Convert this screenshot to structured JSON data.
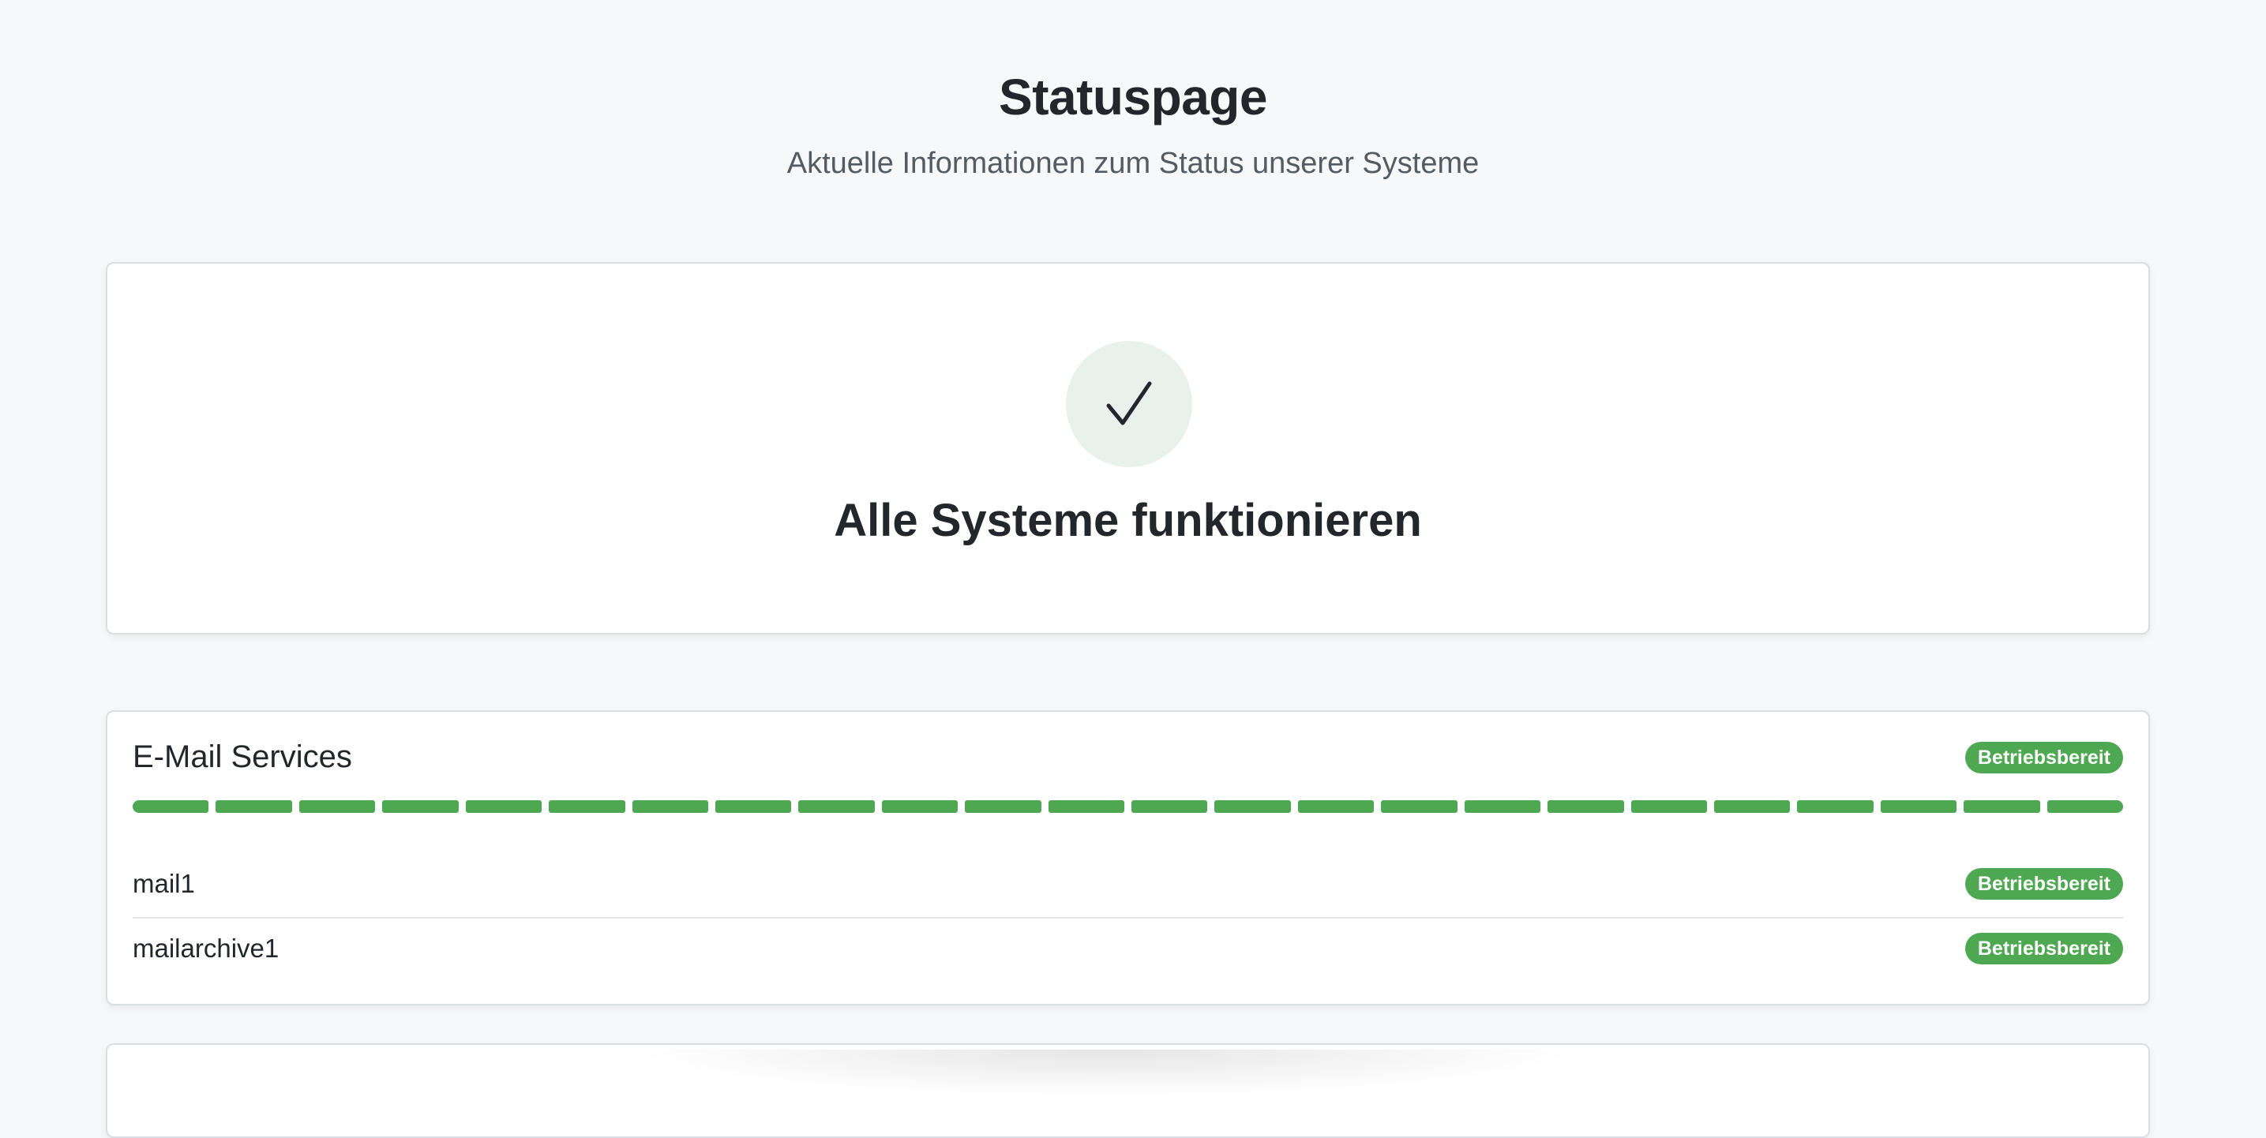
{
  "header": {
    "title": "Statuspage",
    "subtitle": "Aktuelle Informationen zum Status unserer Systeme"
  },
  "overall": {
    "icon": "check-icon",
    "text": "Alle Systeme funktionieren",
    "icon_bg_color": "#e9f1ec"
  },
  "groups": [
    {
      "name": "E-Mail Services",
      "status": "Betriebsbereit",
      "uptime_segments": 24,
      "uptime_color": "#4ea851",
      "services": [
        {
          "name": "mail1",
          "status": "Betriebsbereit"
        },
        {
          "name": "mailarchive1",
          "status": "Betriebsbereit"
        }
      ]
    }
  ],
  "colors": {
    "operational": "#4ea851",
    "background": "#f7f8fa",
    "text": "#23262b"
  }
}
